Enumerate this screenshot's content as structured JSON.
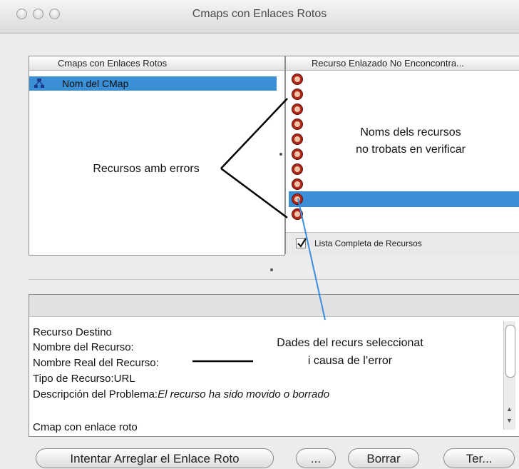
{
  "window": {
    "title": "Cmaps con Enlaces Rotos"
  },
  "left_panel": {
    "header": "Cmaps con Enlaces Rotos",
    "rows": [
      "Nom del CMap"
    ]
  },
  "right_panel": {
    "header": "Recurso Enlazado No Enconcontra...",
    "checkbox_label": "Lista Completa de Recursos",
    "checked": true
  },
  "annotations": {
    "errors": "Recursos amb errors",
    "names_line1": "Noms dels recursos",
    "names_line2": "no trobats en verificar",
    "data_line1": "Dades del recurs seleccionat",
    "data_line2": "i causa de l’error"
  },
  "details": {
    "destino": "Recurso Destino",
    "nombre": "Nombre del Recurso:",
    "nombre_real": "Nombre Real del Recurso:",
    "tipo": "Tipo de Recurso:URL",
    "descripcion_label": "Descripción del Problema:",
    "descripcion_value": "El recurso ha sido movido o borrado",
    "cmap": "Cmap con enlace roto"
  },
  "buttons": {
    "fix": "Intentar Arreglar el Enlace Roto",
    "more": "...",
    "delete": "Borrar",
    "finish": "Ter..."
  }
}
